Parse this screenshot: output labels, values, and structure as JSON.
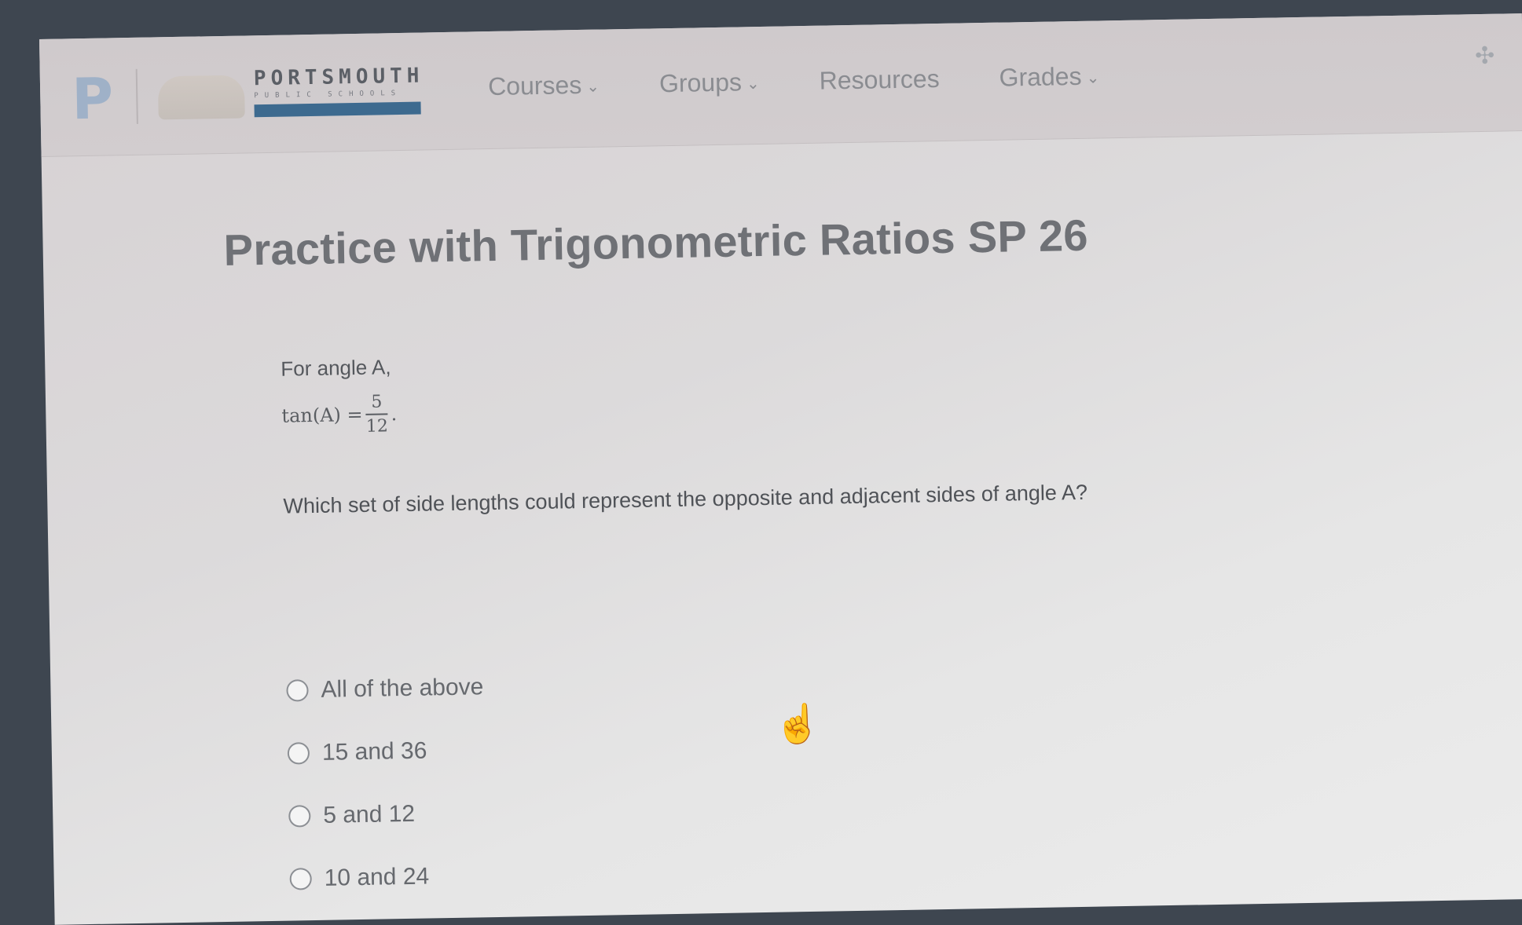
{
  "header": {
    "school_name": "PORTSMOUTH",
    "school_subtitle": "PUBLIC SCHOOLS",
    "nav": [
      {
        "label": "Courses",
        "has_dropdown": true
      },
      {
        "label": "Groups",
        "has_dropdown": true
      },
      {
        "label": "Resources",
        "has_dropdown": false
      },
      {
        "label": "Grades",
        "has_dropdown": true
      }
    ]
  },
  "page": {
    "title": "Practice with Trigonometric Ratios SP 26"
  },
  "question": {
    "intro": "For angle A,",
    "math_lhs": "tan(A) =",
    "math_num": "5",
    "math_den": "12",
    "math_end": ".",
    "prompt": "Which set of side lengths could represent the opposite and adjacent sides of angle A?"
  },
  "options": [
    {
      "label": "All of the above"
    },
    {
      "label": "15 and 36"
    },
    {
      "label": "5 and 12"
    },
    {
      "label": "10 and 24"
    }
  ],
  "colors": {
    "accent": "#3d6a8f",
    "nav_text": "#8a8c91"
  },
  "icons": [
    "p-logo-icon",
    "chevron-down-icon",
    "grid-menu-icon",
    "pointer-hand-icon"
  ]
}
